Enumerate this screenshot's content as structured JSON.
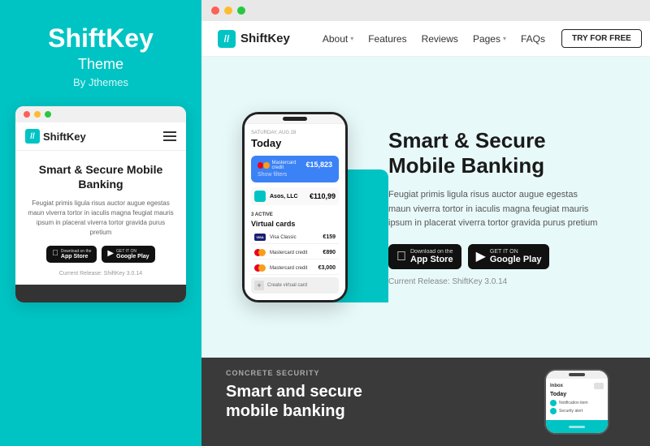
{
  "leftPanel": {
    "title": "ShiftKey",
    "subtitle": "Theme",
    "by": "By Jthemes"
  },
  "miniSite": {
    "logoText": "ShiftKey",
    "heading": "Smart & Secure\nMobile Banking",
    "bodyText": "Feugiat primis ligula risus auctor augue egestas maun viverra tortor in iaculis magna feugiat mauris ipsum in placerat viverra tortor gravida purus pretium",
    "appStore": "App Store",
    "googlePlay": "Google Play",
    "appStoreSmall": "Download on the",
    "googlePlaySmall": "GET IT ON",
    "release": "Current Release: ShiftKey 3.0.14"
  },
  "website": {
    "logoText": "ShiftKey",
    "nav": {
      "about": "About",
      "features": "Features",
      "reviews": "Reviews",
      "pages": "Pages",
      "faqs": "FAQs",
      "tryFree": "TRY FOR FREE"
    },
    "hero": {
      "heading": "Smart & Secure\nMobile Banking",
      "body": "Feugiat primis ligula risus auctor augue egestas maun viverra tortor in iaculis magna feugiat mauris ipsum in placerat viverra tortor gravida purus pretium",
      "appStoreLabel": "Download on the",
      "appStoreName": "App Store",
      "googlePlayLabel": "GET IT ON",
      "googlePlayName": "Google Play",
      "release": "Current Release: ShiftKey 3.0.14"
    },
    "phone": {
      "date": "SATURDAY, AUG 28",
      "today": "Today",
      "cardName": "Mastercard credit",
      "cardAmount": "€15,823",
      "companyName": "Asos, LLC",
      "companyAmount": "€110,99",
      "sectionLabel": "3 ACTIVE",
      "virtualCards": "Virtual cards",
      "visa": "Visa Classic",
      "visaAmount": "€159",
      "mc1": "Mastercard credit",
      "mc1Amount": "€890",
      "mc2": "Mastercard credit",
      "mc2Amount": "€3,000",
      "addCard": "Create virtual card"
    },
    "darkSection": {
      "label": "CONCRETE SECURITY",
      "heading": "Smart and secure\nmobile banking"
    }
  }
}
